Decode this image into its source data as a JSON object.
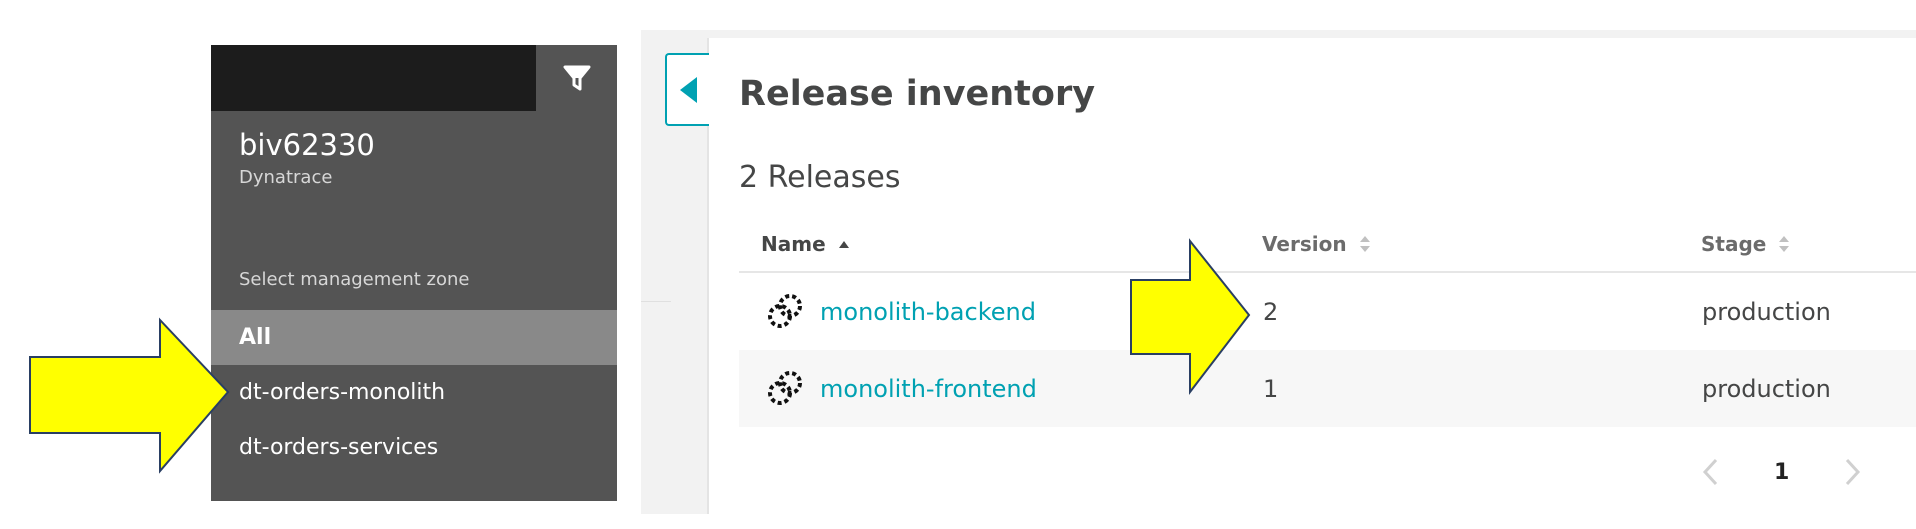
{
  "zone_panel": {
    "environment_name": "biv62330",
    "environment_subtitle": "Dynatrace",
    "select_label": "Select management zone",
    "zones": [
      {
        "label": "All",
        "selected": true
      },
      {
        "label": "dt-orders-monolith",
        "selected": false
      },
      {
        "label": "dt-orders-services",
        "selected": false
      }
    ]
  },
  "main": {
    "title": "Release inventory",
    "count_label": "2 Releases",
    "columns": {
      "name": "Name",
      "version": "Version",
      "stage": "Stage"
    },
    "rows": [
      {
        "name": "monolith-backend",
        "version": "2",
        "stage": "production"
      },
      {
        "name": "monolith-frontend",
        "version": "1",
        "stage": "production"
      }
    ],
    "pagination": {
      "current_page": "1"
    }
  },
  "colors": {
    "accent": "#00a1b2",
    "annotation_arrow": "#ffff00",
    "panel_bg": "#545454",
    "panel_selected": "#898989"
  }
}
